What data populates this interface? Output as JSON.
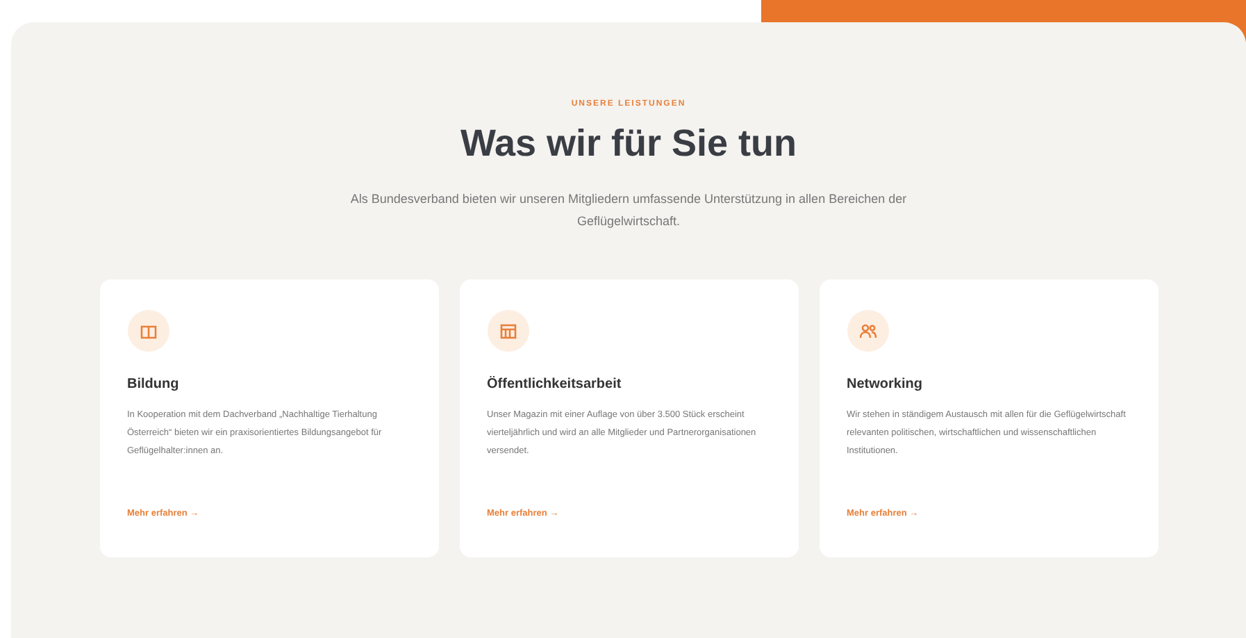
{
  "section": {
    "eyebrow": "UNSERE LEISTUNGEN",
    "title": "Was wir für Sie tun",
    "lead": "Als Bundesverband bieten wir unseren Mitgliedern umfassende Unterstützung in allen Bereichen der Geflügelwirtschaft."
  },
  "cards": [
    {
      "title": "Bildung",
      "text": "In Kooperation mit dem Dachverband „Nachhaltige Tierhaltung Österreich“ bieten wir ein praxisorientiertes Bildungsangebot für Geflügelhalter:innen an.",
      "link": "Mehr erfahren →"
    },
    {
      "title": "Öffentlichkeitsarbeit",
      "text": "Unser Magazin mit einer Auflage von über 3.500 Stück erscheint vierteljährlich und wird an alle Mitglieder und Partnerorganisationen versendet.",
      "link": "Mehr erfahren →"
    },
    {
      "title": "Networking",
      "text": "Wir stehen in ständigem Austausch mit allen für die Geflügelwirtschaft relevanten politischen, wirtschaftlichen und wissenschaftlichen Institutionen.",
      "link": "Mehr erfahren →"
    }
  ]
}
